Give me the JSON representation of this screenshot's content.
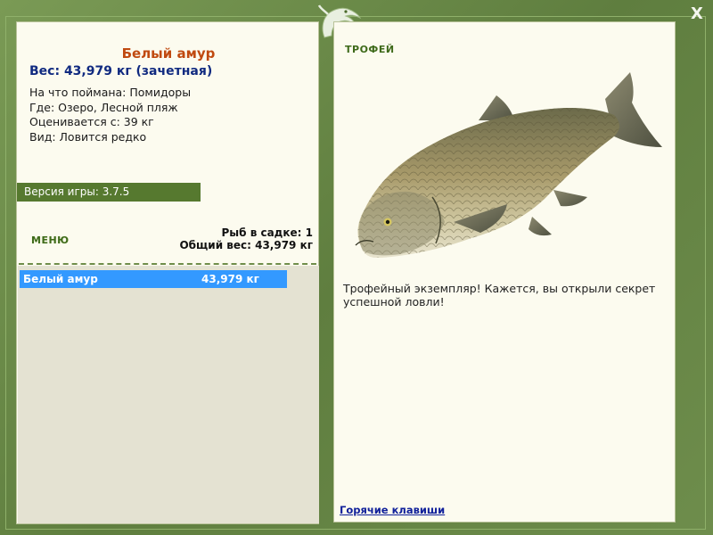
{
  "window": {
    "close_label": "X"
  },
  "fish": {
    "name": "Белый амур",
    "weight": "Вес: 43,979 кг (зачетная)",
    "details": [
      "На что поймана: Помидоры",
      "Где: Озеро, Лесной пляж",
      "Оценивается с: 39 кг",
      "Вид: Ловится редко"
    ]
  },
  "version": {
    "label": "Версия игры: 3.7.5"
  },
  "menu": {
    "label": "МЕНЮ"
  },
  "keepnet": {
    "count": "Рыб в садке: 1",
    "total_weight": "Общий вес: 43,979 кг",
    "rows": [
      {
        "name": "Белый амур",
        "weight": "43,979 кг"
      }
    ]
  },
  "trophy": {
    "label": "ТРОФЕЙ",
    "text": "Трофейный экземпляр! Кажется, вы открыли секрет успешной ловли!",
    "hotkeys_link": "Горячие клавиши"
  },
  "colors": {
    "frame_green": "#6b8a48",
    "panel_bg": "#fcfbef",
    "accent_orange": "#c04a10",
    "weight_blue": "#102a80",
    "selection_blue": "#3399ff"
  }
}
